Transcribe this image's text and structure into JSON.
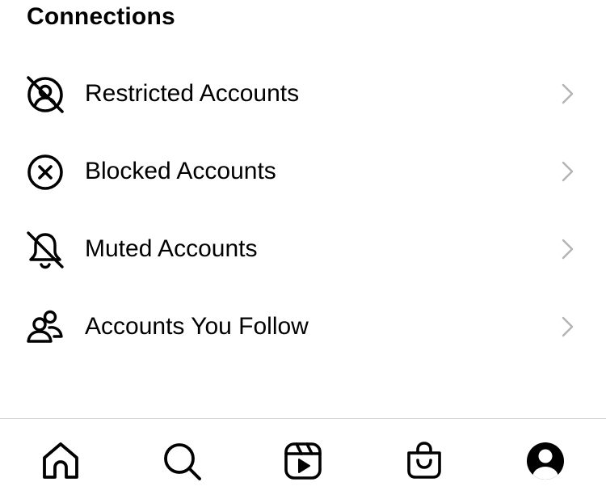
{
  "section": {
    "title": "Connections"
  },
  "menu": {
    "items": [
      {
        "label": "Restricted Accounts",
        "icon": "restricted-icon"
      },
      {
        "label": "Blocked Accounts",
        "icon": "blocked-icon"
      },
      {
        "label": "Muted Accounts",
        "icon": "muted-bell-icon"
      },
      {
        "label": "Accounts You Follow",
        "icon": "people-icon"
      }
    ],
    "chevron_icon": "chevron-right-icon",
    "chevron_color": "#b3b3b3"
  },
  "tabbar": {
    "tabs": [
      {
        "icon": "home-icon"
      },
      {
        "icon": "search-icon"
      },
      {
        "icon": "reels-icon"
      },
      {
        "icon": "shop-icon"
      },
      {
        "icon": "profile-icon"
      }
    ]
  }
}
